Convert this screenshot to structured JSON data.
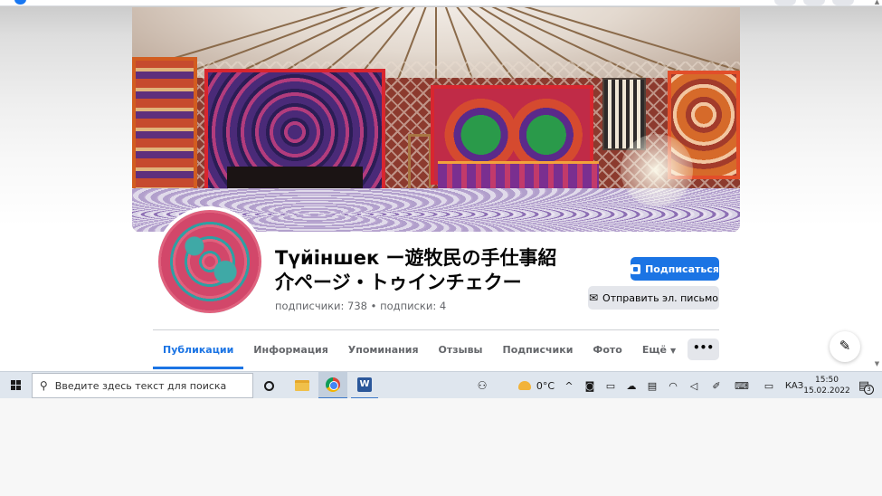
{
  "page": {
    "name": "Түйіншек ー遊牧民の手仕事紹介ページ・トゥインチェクー",
    "stats": {
      "followers": "подписчики: 738",
      "separator": "•",
      "following": "подписки: 4"
    }
  },
  "actions": {
    "subscribe_label": "Подписаться",
    "email_label": "Отправить эл. письмо",
    "more_label": "•••"
  },
  "tabs": [
    {
      "label": "Публикации",
      "active": true
    },
    {
      "label": "Информация"
    },
    {
      "label": "Упоминания"
    },
    {
      "label": "Отзывы"
    },
    {
      "label": "Подписчики"
    },
    {
      "label": "Фото"
    },
    {
      "label": "Ещё"
    }
  ],
  "icons": {
    "compose": "✎",
    "email": "✉",
    "caret": "▼",
    "scroll_up": "▲",
    "scroll_down": "▼"
  },
  "taskbar": {
    "search_placeholder": "Введите здесь текст для поиска",
    "search_icon": "⚲",
    "weather_temp": "0°C",
    "tray_chevron": "^",
    "language": "КАЗ",
    "time": "15:50",
    "date": "15.02.2022",
    "notification_count": "3",
    "word_letter": "W"
  },
  "colors": {
    "accent": "#1b74e4",
    "secondary_button": "#e4e6eb",
    "taskbar": "#dfe6ee"
  }
}
